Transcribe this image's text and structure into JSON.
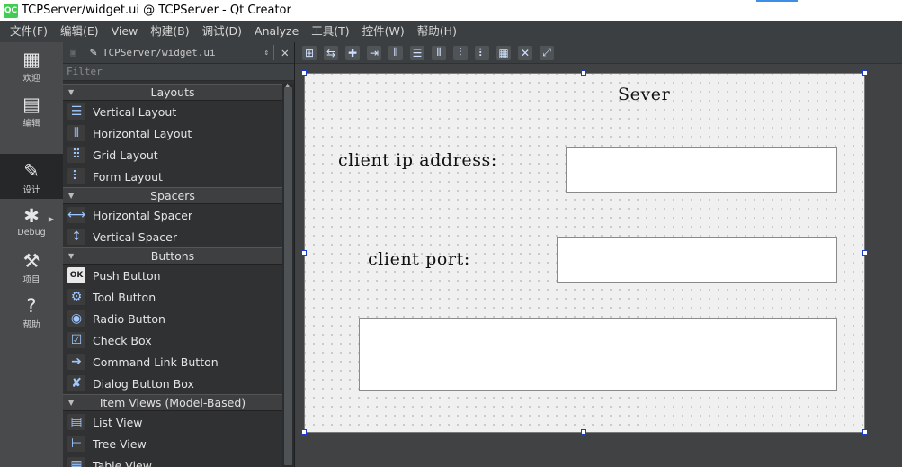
{
  "window": {
    "title": "TCPServer/widget.ui @ TCPServer - Qt Creator",
    "app_icon": "QC"
  },
  "menu": [
    "文件(F)",
    "编辑(E)",
    "View",
    "构建(B)",
    "调试(D)",
    "Analyze",
    "工具(T)",
    "控件(W)",
    "帮助(H)"
  ],
  "modes": [
    {
      "icon": "welcome-grid-icon",
      "glyph": "▦",
      "label": "欢迎"
    },
    {
      "icon": "edit-document-icon",
      "glyph": "▤",
      "label": "编辑"
    },
    {
      "icon": "design-pencil-icon",
      "glyph": "✎",
      "label": "设计"
    },
    {
      "icon": "debug-bug-icon",
      "glyph": "✱",
      "label": "Debug"
    },
    {
      "icon": "projects-wrench-icon",
      "glyph": "⚒",
      "label": "项目"
    },
    {
      "icon": "help-question-icon",
      "glyph": "?",
      "label": "帮助"
    }
  ],
  "widgetbox": {
    "file": "TCPServer/widget.ui",
    "filter_placeholder": "Filter",
    "categories": [
      {
        "name": "Layouts",
        "items": [
          {
            "label": "Vertical Layout",
            "icon": "vertical-layout-icon",
            "glyph": "☰"
          },
          {
            "label": "Horizontal Layout",
            "icon": "horizontal-layout-icon",
            "glyph": "⦀"
          },
          {
            "label": "Grid Layout",
            "icon": "grid-layout-icon",
            "glyph": "⠿"
          },
          {
            "label": "Form Layout",
            "icon": "form-layout-icon",
            "glyph": "⠇"
          }
        ]
      },
      {
        "name": "Spacers",
        "items": [
          {
            "label": "Horizontal Spacer",
            "icon": "horizontal-spacer-icon",
            "glyph": "⟷"
          },
          {
            "label": "Vertical Spacer",
            "icon": "vertical-spacer-icon",
            "glyph": "↕"
          }
        ]
      },
      {
        "name": "Buttons",
        "items": [
          {
            "label": "Push Button",
            "icon": "push-button-icon",
            "glyph": "OK"
          },
          {
            "label": "Tool Button",
            "icon": "tool-button-icon",
            "glyph": "⚙"
          },
          {
            "label": "Radio Button",
            "icon": "radio-button-icon",
            "glyph": "◉"
          },
          {
            "label": "Check Box",
            "icon": "check-box-icon",
            "glyph": "☑"
          },
          {
            "label": "Command Link Button",
            "icon": "command-link-icon",
            "glyph": "➔"
          },
          {
            "label": "Dialog Button Box",
            "icon": "dialog-button-box-icon",
            "glyph": "✘"
          }
        ]
      },
      {
        "name": "Item Views (Model-Based)",
        "items": [
          {
            "label": "List View",
            "icon": "list-view-icon",
            "glyph": "▤"
          },
          {
            "label": "Tree View",
            "icon": "tree-view-icon",
            "glyph": "⊢"
          },
          {
            "label": "Table View",
            "icon": "table-view-icon",
            "glyph": "▦"
          }
        ]
      }
    ]
  },
  "toolbar": [
    "edit-widgets-icon",
    "edit-signals-icon",
    "edit-buddies-icon",
    "edit-tab-order-icon",
    "layout-horizontal-icon",
    "layout-vertical-icon",
    "layout-h-splitter-icon",
    "layout-v-splitter-icon",
    "layout-form-icon",
    "layout-grid-icon",
    "break-layout-icon",
    "adjust-size-icon"
  ],
  "form": {
    "title": "Sever",
    "ip_label": "client ip address:",
    "port_label": "client port:"
  },
  "colors": {
    "accent": "#1a3ccf",
    "active_mode_bg": "#262728"
  }
}
